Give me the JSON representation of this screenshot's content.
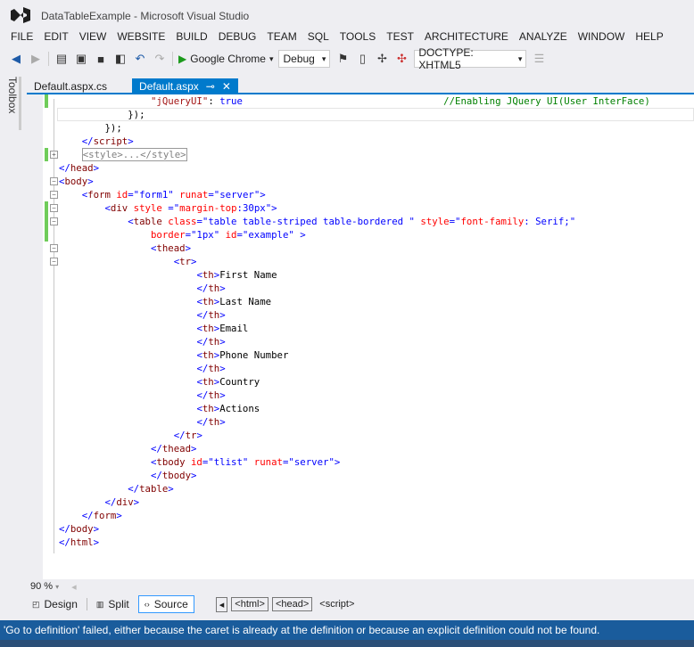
{
  "window": {
    "title": "DataTableExample - Microsoft Visual Studio"
  },
  "menu": [
    "FILE",
    "EDIT",
    "VIEW",
    "WEBSITE",
    "BUILD",
    "DEBUG",
    "TEAM",
    "SQL",
    "TOOLS",
    "TEST",
    "ARCHITECTURE",
    "ANALYZE",
    "WINDOW",
    "HELP"
  ],
  "toolbar": {
    "browser": "Google Chrome",
    "config": "Debug",
    "doctype": "DOCTYPE: XHTML5"
  },
  "toolbox_label": "Toolbox",
  "tabs": [
    {
      "label": "Default.aspx.cs",
      "active": false
    },
    {
      "label": "Default.aspx",
      "active": true
    }
  ],
  "code": [
    {
      "i": 16,
      "chg": true,
      "tk": [
        [
          "s",
          "\"jQueryUI\""
        ],
        [
          "x",
          ": "
        ],
        [
          "k",
          "true"
        ],
        [
          "x",
          "                                   "
        ],
        [
          "c",
          "//Enabling JQuery UI(User InterFace)"
        ]
      ]
    },
    {
      "i": 12,
      "tk": [
        [
          "x",
          "});"
        ]
      ]
    },
    {
      "i": 8,
      "tk": [
        [
          "x",
          "});"
        ]
      ]
    },
    {
      "i": 4,
      "tk": [
        [
          "t",
          "</"
        ],
        [
          "e",
          "script"
        ],
        [
          "t",
          ">"
        ]
      ]
    },
    {
      "i": 4,
      "fold": "+",
      "chg": true,
      "tk": [
        [
          "b",
          "<style>...</style>"
        ]
      ]
    },
    {
      "i": 0,
      "tk": [
        [
          "t",
          "</"
        ],
        [
          "e",
          "head"
        ],
        [
          "t",
          ">"
        ]
      ]
    },
    {
      "i": 0,
      "fold": "-",
      "tk": [
        [
          "t",
          "<"
        ],
        [
          "e",
          "body"
        ],
        [
          "t",
          ">"
        ]
      ]
    },
    {
      "i": 4,
      "fold": "-",
      "tk": [
        [
          "t",
          "<"
        ],
        [
          "e",
          "form "
        ],
        [
          "a",
          "id"
        ],
        [
          "t",
          "=\"form1\" "
        ],
        [
          "a",
          "runat"
        ],
        [
          "t",
          "=\"server\">"
        ]
      ]
    },
    {
      "i": 8,
      "fold": "-",
      "chg": true,
      "tk": [
        [
          "t",
          "<"
        ],
        [
          "e",
          "div "
        ],
        [
          "a",
          "style "
        ],
        [
          "t",
          "=\""
        ],
        [
          "a",
          "margin-top"
        ],
        [
          "t",
          ":30px\">"
        ]
      ]
    },
    {
      "i": 12,
      "fold": "-",
      "chg": true,
      "tk": [
        [
          "t",
          "<"
        ],
        [
          "e",
          "table "
        ],
        [
          "a",
          "class"
        ],
        [
          "t",
          "=\"table table-striped table-bordered \" "
        ],
        [
          "a",
          "style"
        ],
        [
          "t",
          "=\""
        ],
        [
          "a",
          "font-family"
        ],
        [
          "t",
          ": Serif;\""
        ]
      ]
    },
    {
      "i": 16,
      "chg": true,
      "tk": [
        [
          "a",
          "border"
        ],
        [
          "t",
          "=\"1px\" "
        ],
        [
          "a",
          "id"
        ],
        [
          "t",
          "=\"example\" >"
        ]
      ]
    },
    {
      "i": 16,
      "fold": "-",
      "tk": [
        [
          "t",
          "<"
        ],
        [
          "e",
          "thead"
        ],
        [
          "t",
          ">"
        ]
      ]
    },
    {
      "i": 20,
      "fold": "-",
      "tk": [
        [
          "t",
          "<"
        ],
        [
          "e",
          "tr"
        ],
        [
          "t",
          ">"
        ]
      ]
    },
    {
      "i": 24,
      "tk": [
        [
          "t",
          "<"
        ],
        [
          "e",
          "th"
        ],
        [
          "t",
          ">"
        ],
        [
          "x",
          "First Name"
        ]
      ]
    },
    {
      "i": 24,
      "tk": [
        [
          "t",
          "</"
        ],
        [
          "e",
          "th"
        ],
        [
          "t",
          ">"
        ]
      ]
    },
    {
      "i": 24,
      "tk": [
        [
          "t",
          "<"
        ],
        [
          "e",
          "th"
        ],
        [
          "t",
          ">"
        ],
        [
          "x",
          "Last Name"
        ]
      ]
    },
    {
      "i": 24,
      "tk": [
        [
          "t",
          "</"
        ],
        [
          "e",
          "th"
        ],
        [
          "t",
          ">"
        ]
      ]
    },
    {
      "i": 24,
      "tk": [
        [
          "t",
          "<"
        ],
        [
          "e",
          "th"
        ],
        [
          "t",
          ">"
        ],
        [
          "x",
          "Email"
        ]
      ]
    },
    {
      "i": 24,
      "tk": [
        [
          "t",
          "</"
        ],
        [
          "e",
          "th"
        ],
        [
          "t",
          ">"
        ]
      ]
    },
    {
      "i": 24,
      "tk": [
        [
          "t",
          "<"
        ],
        [
          "e",
          "th"
        ],
        [
          "t",
          ">"
        ],
        [
          "x",
          "Phone Number"
        ]
      ]
    },
    {
      "i": 24,
      "tk": [
        [
          "t",
          "</"
        ],
        [
          "e",
          "th"
        ],
        [
          "t",
          ">"
        ]
      ]
    },
    {
      "i": 24,
      "tk": [
        [
          "t",
          "<"
        ],
        [
          "e",
          "th"
        ],
        [
          "t",
          ">"
        ],
        [
          "x",
          "Country"
        ]
      ]
    },
    {
      "i": 24,
      "tk": [
        [
          "t",
          "</"
        ],
        [
          "e",
          "th"
        ],
        [
          "t",
          ">"
        ]
      ]
    },
    {
      "i": 24,
      "tk": [
        [
          "t",
          "<"
        ],
        [
          "e",
          "th"
        ],
        [
          "t",
          ">"
        ],
        [
          "x",
          "Actions"
        ]
      ]
    },
    {
      "i": 24,
      "tk": [
        [
          "t",
          "</"
        ],
        [
          "e",
          "th"
        ],
        [
          "t",
          ">"
        ]
      ]
    },
    {
      "i": 20,
      "tk": [
        [
          "t",
          "</"
        ],
        [
          "e",
          "tr"
        ],
        [
          "t",
          ">"
        ]
      ]
    },
    {
      "i": 16,
      "tk": [
        [
          "t",
          "</"
        ],
        [
          "e",
          "thead"
        ],
        [
          "t",
          ">"
        ]
      ]
    },
    {
      "i": 16,
      "tk": [
        [
          "t",
          "<"
        ],
        [
          "e",
          "tbody "
        ],
        [
          "a",
          "id"
        ],
        [
          "t",
          "=\"tlist\" "
        ],
        [
          "a",
          "runat"
        ],
        [
          "t",
          "=\"server\">"
        ]
      ]
    },
    {
      "i": 16,
      "tk": [
        [
          "t",
          "</"
        ],
        [
          "e",
          "tbody"
        ],
        [
          "t",
          ">"
        ]
      ]
    },
    {
      "i": 12,
      "tk": [
        [
          "t",
          "</"
        ],
        [
          "e",
          "table"
        ],
        [
          "t",
          ">"
        ]
      ]
    },
    {
      "i": 8,
      "tk": [
        [
          "t",
          "</"
        ],
        [
          "e",
          "div"
        ],
        [
          "t",
          ">"
        ]
      ]
    },
    {
      "i": 4,
      "tk": [
        [
          "t",
          "</"
        ],
        [
          "e",
          "form"
        ],
        [
          "t",
          ">"
        ]
      ]
    },
    {
      "i": 0,
      "tk": [
        [
          "t",
          "</"
        ],
        [
          "e",
          "body"
        ],
        [
          "t",
          ">"
        ]
      ]
    },
    {
      "i": 0,
      "tk": [
        [
          "t",
          "</"
        ],
        [
          "e",
          "html"
        ],
        [
          "t",
          ">"
        ]
      ]
    }
  ],
  "zoom": "90 %",
  "views": {
    "design": "Design",
    "split": "Split",
    "source": "Source"
  },
  "breadcrumbs": [
    "<html>",
    "<head>",
    "<script>"
  ],
  "status": "'Go to definition' failed, either because the caret is already at the definition or because an explicit definition could not be found."
}
